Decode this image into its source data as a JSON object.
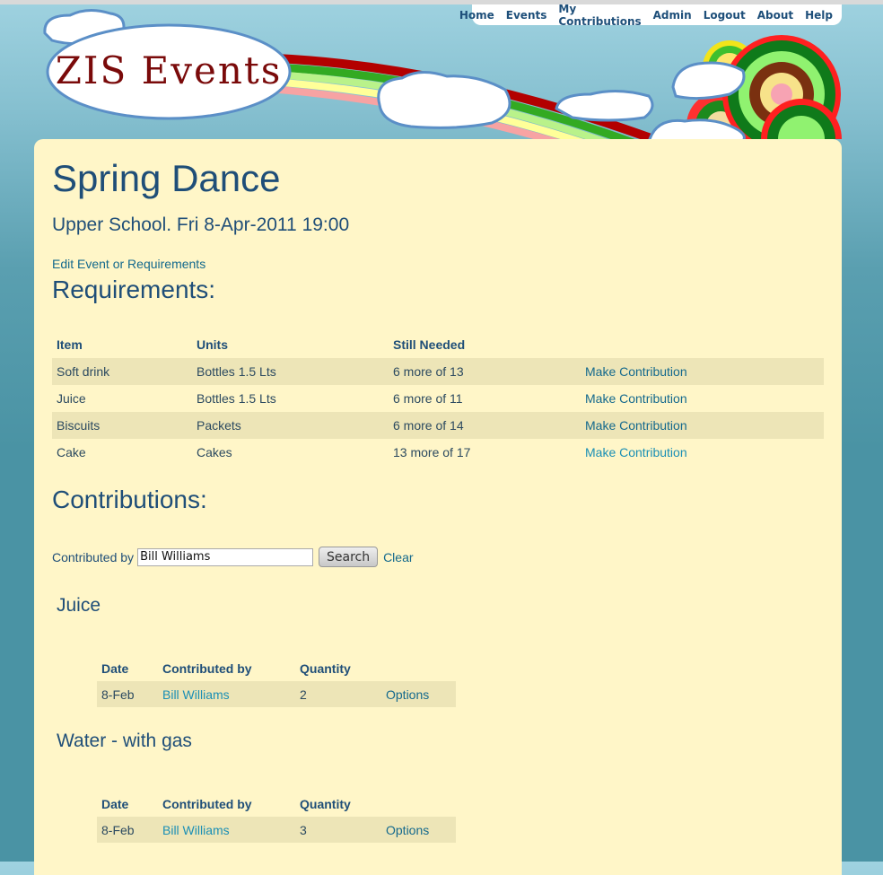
{
  "logo": {
    "text": "ZIS Events"
  },
  "nav": [
    "Home",
    "Events",
    "My Contributions",
    "Admin",
    "Logout",
    "About",
    "Help"
  ],
  "event": {
    "title": "Spring Dance",
    "subtitle": "Upper School. Fri 8-Apr-2011 19:00",
    "edit_link": "Edit Event or Requirements"
  },
  "requirements": {
    "heading": "Requirements:",
    "columns": [
      "Item",
      "Units",
      "Still Needed",
      ""
    ],
    "rows": [
      {
        "item": "Soft drink",
        "units": "Bottles 1.5 Lts",
        "needed": "6 more of 13",
        "action": "Make Contribution"
      },
      {
        "item": "Juice",
        "units": "Bottles 1.5 Lts",
        "needed": "6 more of 11",
        "action": "Make Contribution"
      },
      {
        "item": "Biscuits",
        "units": "Packets",
        "needed": "6 more of 14",
        "action": "Make Contribution"
      },
      {
        "item": "Cake",
        "units": "Cakes",
        "needed": "13 more of 17",
        "action": "Make Contribution"
      }
    ]
  },
  "contributions": {
    "heading": "Contributions:",
    "filter_label": "Contributed by",
    "filter_value": "Bill Williams",
    "search_label": "Search",
    "clear_label": "Clear",
    "columns": [
      "Date",
      "Contributed by",
      "Quantity",
      ""
    ],
    "groups": [
      {
        "title": "Juice",
        "rows": [
          {
            "date": "8-Feb",
            "by": "Bill Williams",
            "qty": "2",
            "action": "Options"
          }
        ]
      },
      {
        "title": "Water - with gas",
        "rows": [
          {
            "date": "8-Feb",
            "by": "Bill Williams",
            "qty": "3",
            "action": "Options"
          }
        ]
      }
    ]
  },
  "colors": {
    "panel": "#fff6c8",
    "heading": "#1f4e78",
    "link": "#14698d",
    "row_alt": "#ede5b7"
  }
}
